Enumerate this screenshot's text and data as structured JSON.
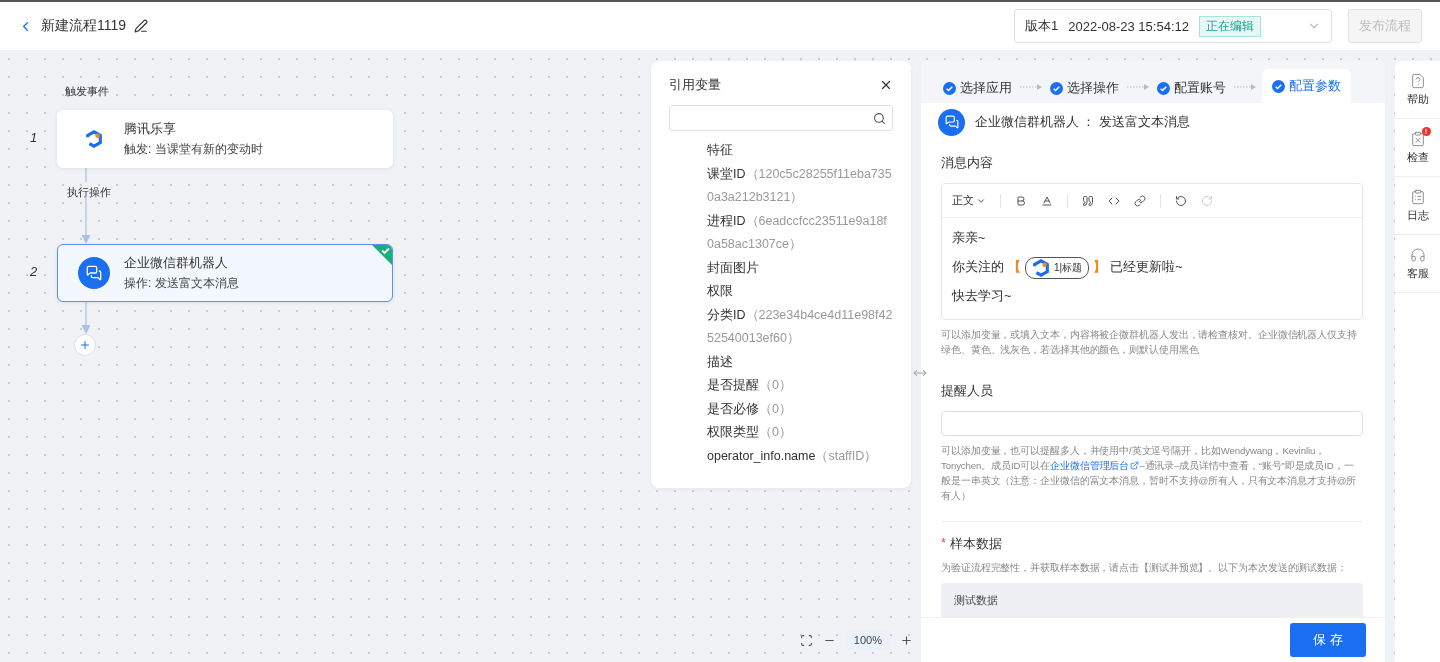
{
  "header": {
    "title": "新建流程1119",
    "version": {
      "label": "版本1",
      "time": "2022-08-23 15:54:12",
      "status": "正在编辑"
    },
    "publish": {
      "label": "发布流程",
      "disabled": true
    }
  },
  "canvas": {
    "trigger_label": "触发事件",
    "action_label": "执行操作",
    "nodes": [
      {
        "index": "1",
        "kind": "trigger",
        "title": "腾讯乐享",
        "subtitle": "触发: 当课堂有新的变动时",
        "selected": false,
        "done": false
      },
      {
        "index": "2",
        "kind": "action",
        "title": "企业微信群机器人",
        "subtitle": "操作: 发送富文本消息",
        "selected": true,
        "done": true
      }
    ],
    "zoom": "100%"
  },
  "variables": {
    "title": "引用变量",
    "items": [
      {
        "name": "特征"
      },
      {
        "name": "课堂ID",
        "value": "（120c5c28255f11eba7350a3a212b3121）"
      },
      {
        "name": "进程ID",
        "value": "（6eadccfcc23511e9a18f0a58ac1307ce）"
      },
      {
        "name": "封面图片"
      },
      {
        "name": "权限"
      },
      {
        "name": "分类ID",
        "value": "（223e34b4ce4d11e98f4252540013ef60）"
      },
      {
        "name": "描述"
      },
      {
        "name": "是否提醒",
        "value": "（0）"
      },
      {
        "name": "是否必修",
        "value": "（0）"
      },
      {
        "name": "权限类型",
        "value": "（0）"
      },
      {
        "name": "operator_info.name",
        "value": "（staffID）"
      }
    ]
  },
  "config": {
    "steps": [
      {
        "label": "选择应用",
        "selected": false
      },
      {
        "label": "选择操作",
        "selected": false
      },
      {
        "label": "配置账号",
        "selected": false
      },
      {
        "label": "配置参数",
        "selected": true
      }
    ],
    "app_title": "企业微信群机器人 ： 发送富文本消息",
    "message": {
      "label": "消息内容",
      "format": "正文",
      "tools": [
        {
          "kind": "bold",
          "disabled": false
        },
        {
          "kind": "color",
          "disabled": false
        },
        {
          "kind": "quote",
          "disabled": false
        },
        {
          "kind": "code",
          "disabled": false
        },
        {
          "kind": "link",
          "disabled": false
        },
        {
          "kind": "undo",
          "disabled": false
        },
        {
          "kind": "redo",
          "disabled": true
        }
      ],
      "lines": [
        {
          "kind": "text",
          "text": "亲亲~"
        },
        {
          "kind": "variable",
          "before": "你关注的",
          "open": "【",
          "chip": "1|标题",
          "close": "】",
          "after": "已经更新啦~"
        },
        {
          "kind": "text",
          "text": "快去学习~"
        }
      ],
      "hint": "可以添加变量，或填入文本，内容将被企微群机器人发出，请检查核对。企业微信机器人仅支持绿色、黄色、浅灰色，若选择其他的颜色，则默认使用黑色"
    },
    "reminder": {
      "label": "提醒人员",
      "hint_before": "可以添加变量，也可以提醒多人，并使用中/英文逗号隔开，比如Wendywang，Kevinliu，Tonychen。成员ID可以在",
      "hint_link": "企业微信管理后台",
      "hint_after": "–通讯录–成员详情中查看，“账号”即是成员ID，一般是一串英文（注意：企业微信的富文本消息，暂时不支持@所有人，只有文本消息才支持@所有人）"
    },
    "sample": {
      "label": "样本数据",
      "required_mark": "*",
      "desc": "为验证流程完整性，并获取样本数据，请点击【测试并预览】。以下为本次发送的测试数据：",
      "box_title": "测试数据"
    },
    "save": "保 存"
  },
  "sidebar": [
    {
      "kind": "help",
      "label": "帮助"
    },
    {
      "kind": "check",
      "label": "检查",
      "badge": "!"
    },
    {
      "kind": "log",
      "label": "日志"
    },
    {
      "kind": "service",
      "label": "客服"
    }
  ]
}
